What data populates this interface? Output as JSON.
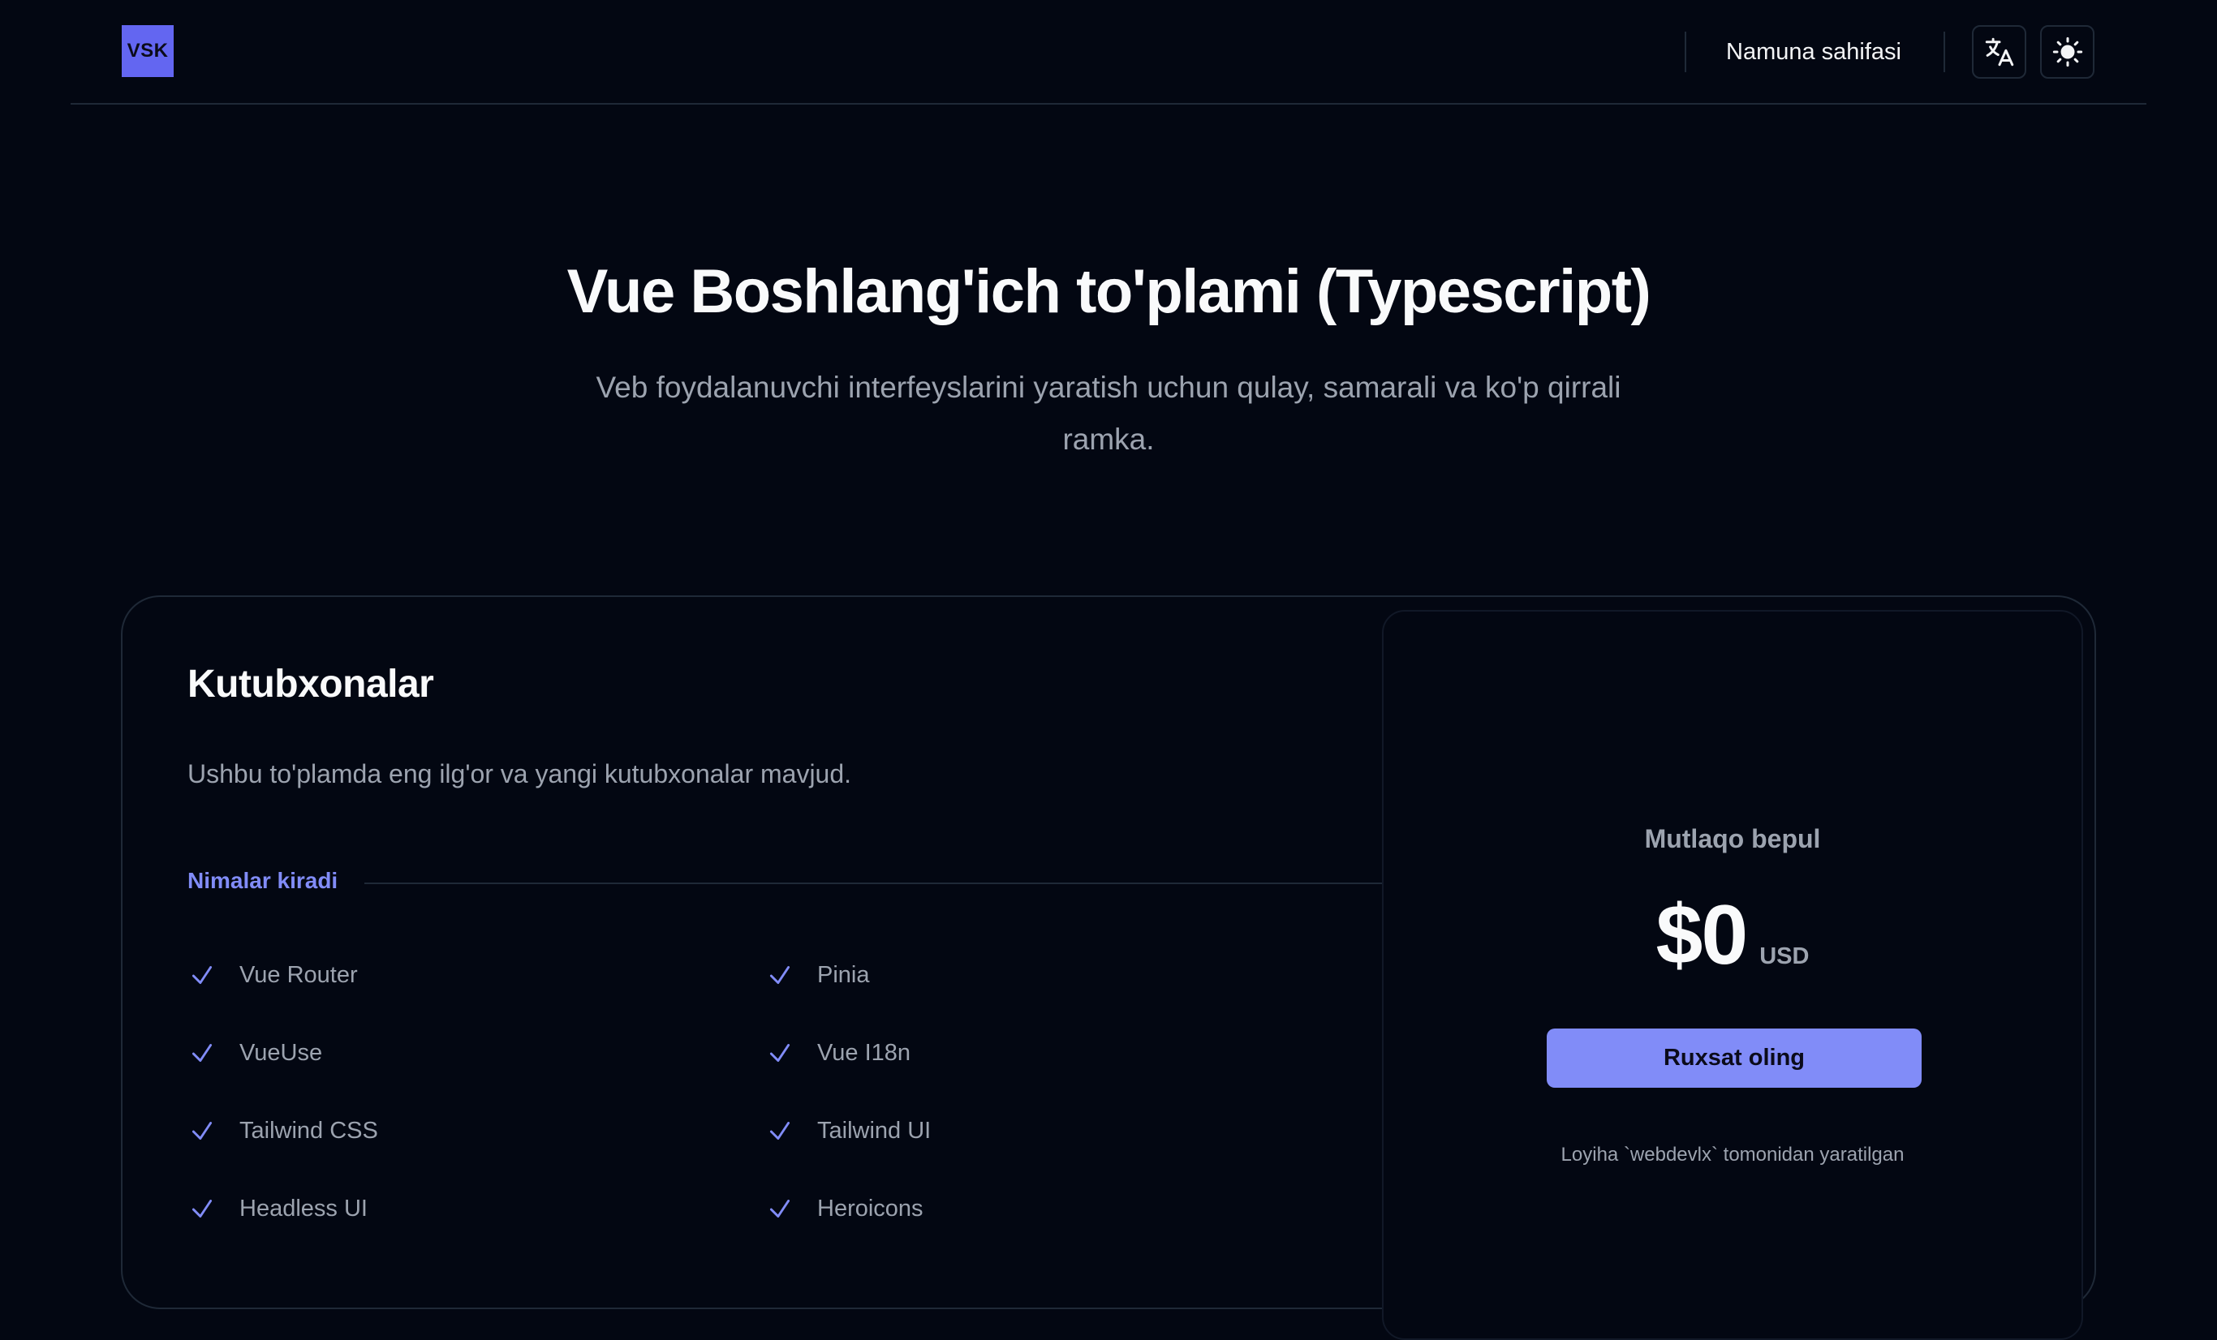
{
  "header": {
    "logo_text": "VSK",
    "nav_link": "Namuna sahifasi",
    "translate_icon": "translate-icon",
    "theme_icon": "sun-icon"
  },
  "hero": {
    "title": "Vue Boshlang'ich to'plami (Typescript)",
    "subtitle": "Veb foydalanuvchi interfeyslarini yaratish uchun qulay, samarali va ko'p qirrali ramka."
  },
  "card": {
    "title": "Kutubxonalar",
    "description": "Ushbu to'plamda eng ilg'or va yangi kutubxonalar mavjud.",
    "included_label": "Nimalar kiradi",
    "features": [
      "Vue Router",
      "Pinia",
      "VueUse",
      "Vue I18n",
      "Tailwind CSS",
      "Tailwind UI",
      "Headless UI",
      "Heroicons"
    ],
    "check_icon": "check-icon"
  },
  "pricing": {
    "label": "Mutlaqo bepul",
    "amount": "$0",
    "currency": "USD",
    "cta_label": "Ruxsat oling",
    "credit": "Loyiha `webdevlx` tomonidan yaratilgan"
  },
  "colors": {
    "background": "#030712",
    "accent": "#818cf8",
    "logo": "#6366f1",
    "border": "#1f2937",
    "muted_text": "#9ca3af"
  }
}
